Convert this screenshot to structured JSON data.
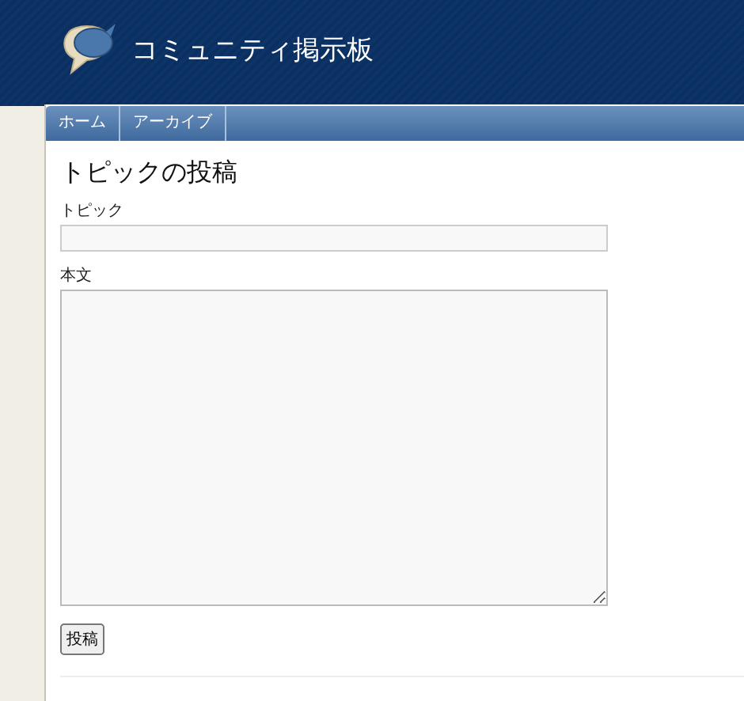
{
  "site": {
    "title": "コミュニティ掲示板"
  },
  "nav": [
    {
      "label": "ホーム"
    },
    {
      "label": "アーカイブ"
    }
  ],
  "page": {
    "heading": "トピックの投稿"
  },
  "form": {
    "topic_label": "トピック",
    "body_label": "本文",
    "submit": "投稿"
  }
}
